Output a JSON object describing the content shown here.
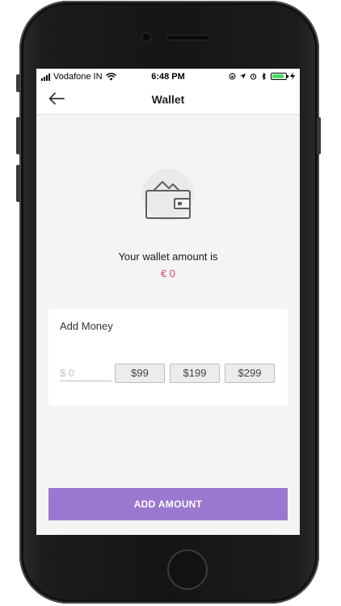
{
  "status_bar": {
    "carrier": "Vodafone IN",
    "time": "6:48 PM",
    "battery_level": 0.9
  },
  "header": {
    "title": "Wallet",
    "back_icon": "back-arrow-icon"
  },
  "wallet": {
    "icon": "wallet-icon",
    "balance_label": "Your wallet amount is",
    "balance_value": "€ 0"
  },
  "add_money": {
    "title": "Add Money",
    "input_placeholder": "$ 0",
    "presets": [
      "$99",
      "$199",
      "$299"
    ]
  },
  "cta": {
    "label": "ADD AMOUNT"
  },
  "colors": {
    "accent": "#9a78cf",
    "balance": "#e0457b"
  }
}
